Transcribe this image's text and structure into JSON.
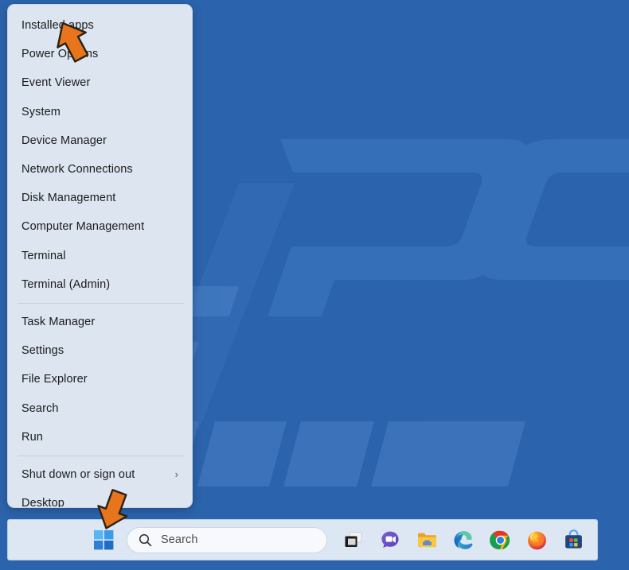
{
  "desktop": {
    "background_color": "#2b63ac",
    "watermark_text": "PCrisk.com"
  },
  "winx_menu": {
    "name": "Win+X quick link menu",
    "background_color": "#dce5f0",
    "groups": [
      {
        "items": [
          {
            "label": "Installed apps",
            "has_submenu": false
          },
          {
            "label": "Power Options",
            "has_submenu": false
          },
          {
            "label": "Event Viewer",
            "has_submenu": false
          },
          {
            "label": "System",
            "has_submenu": false
          },
          {
            "label": "Device Manager",
            "has_submenu": false
          },
          {
            "label": "Network Connections",
            "has_submenu": false
          },
          {
            "label": "Disk Management",
            "has_submenu": false
          },
          {
            "label": "Computer Management",
            "has_submenu": false
          },
          {
            "label": "Terminal",
            "has_submenu": false
          },
          {
            "label": "Terminal (Admin)",
            "has_submenu": false
          }
        ]
      },
      {
        "items": [
          {
            "label": "Task Manager",
            "has_submenu": false
          },
          {
            "label": "Settings",
            "has_submenu": false
          },
          {
            "label": "File Explorer",
            "has_submenu": false
          },
          {
            "label": "Search",
            "has_submenu": false
          },
          {
            "label": "Run",
            "has_submenu": false
          }
        ]
      },
      {
        "items": [
          {
            "label": "Shut down or sign out",
            "has_submenu": true,
            "submenu_glyph": "›"
          },
          {
            "label": "Desktop",
            "has_submenu": false
          }
        ]
      }
    ]
  },
  "taskbar": {
    "background_color": "#dce7f3",
    "start_button": {
      "name": "start-button",
      "label": "Start"
    },
    "search": {
      "placeholder": "Search",
      "value": "",
      "icon": "search-icon"
    },
    "icons": [
      {
        "name": "task-view-icon",
        "label": "Task View"
      },
      {
        "name": "chat-icon",
        "label": "Chat"
      },
      {
        "name": "file-explorer-icon",
        "label": "File Explorer"
      },
      {
        "name": "microsoft-edge-icon",
        "label": "Microsoft Edge"
      },
      {
        "name": "google-chrome-icon",
        "label": "Google Chrome"
      },
      {
        "name": "mozilla-firefox-icon",
        "label": "Mozilla Firefox"
      },
      {
        "name": "microsoft-store-icon",
        "label": "Microsoft Store"
      }
    ]
  },
  "annotations": {
    "arrow_color": "#e8741c",
    "arrows": [
      {
        "name": "arrow-pointing-installed-apps",
        "points_to": "Installed apps"
      },
      {
        "name": "arrow-pointing-start-button",
        "points_to": "Start button"
      }
    ]
  }
}
